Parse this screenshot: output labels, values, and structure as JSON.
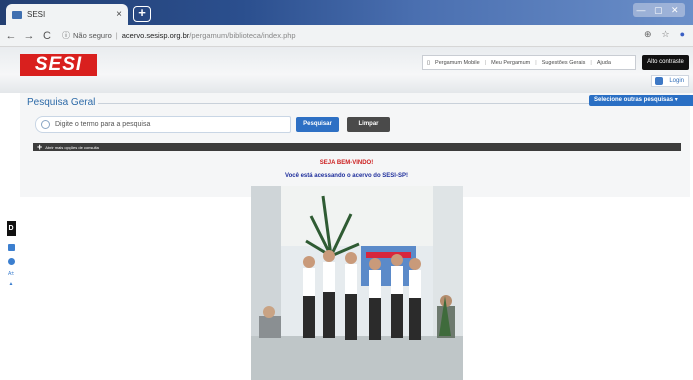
{
  "browser": {
    "tab_title": "SESI",
    "tab_close": "×",
    "new_tab": "+",
    "window_controls": "— ▢ ✕",
    "back": "←",
    "forward": "→",
    "reload": "C",
    "info_icon": "ⓘ",
    "security_label": "Não seguro",
    "separator": "|",
    "url_host": "acervo.sesisp.org.br",
    "url_path": "/pergamum/biblioteca/index.php",
    "zoom_icon": "⊕",
    "star_icon": "☆"
  },
  "header": {
    "logo": "SESI",
    "menu": [
      "Pergamum Mobile",
      "Meu Pergamum",
      "Sugestões Gerais",
      "Ajuda"
    ],
    "contrast_button": "Alto contraste",
    "login": "Login"
  },
  "search": {
    "title": "Pesquisa Geral",
    "select_other": "Selecione outras pesquisas",
    "placeholder": "Digite o termo para a pesquisa",
    "search_button": "Pesquisar",
    "clear_button": "Limpar",
    "more_options": "Abrir mais opções de consulta"
  },
  "main": {
    "welcome": "SEJA BEM-VINDO!",
    "subtitle": "Você está acessando o acervo do SESI-SP!"
  },
  "accessibility": {
    "d_label": "D",
    "text_size": "A±"
  },
  "colors": {
    "brand_red": "#d9201e",
    "accent_blue": "#2e70c4"
  }
}
